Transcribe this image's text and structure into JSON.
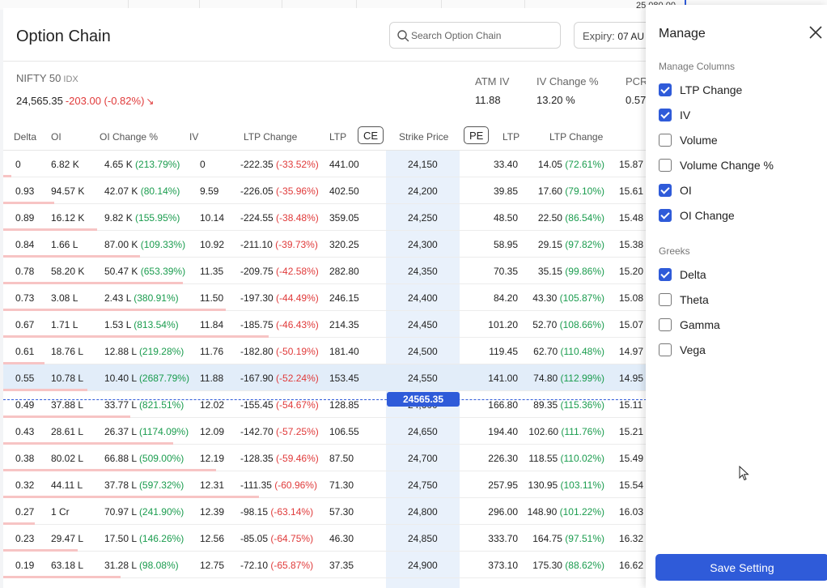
{
  "background_chart": {
    "price_label": "25,080.00"
  },
  "header": {
    "title": "Option Chain",
    "search_placeholder": "Search Option Chain",
    "expiry_label": "Expiry:",
    "expiry_value": "07 AU"
  },
  "instrument": {
    "name": "NIFTY 50",
    "type": "IDX",
    "ltp": "24,565.35",
    "change": "-203.00 (-0.82%)"
  },
  "stats": [
    {
      "label": "ATM IV",
      "value": "11.88"
    },
    {
      "label": "IV Change %",
      "value": "13.20 %"
    },
    {
      "label": "PCR",
      "value": "0.57"
    }
  ],
  "columns": {
    "delta": "Delta",
    "oi": "OI",
    "oi_change_pct": "OI Change %",
    "iv": "IV",
    "ltp_change_ce": "LTP Change",
    "ltp_ce": "LTP",
    "ce_badge": "CE",
    "strike": "Strike Price",
    "pe_badge": "PE",
    "ltp_pe": "LTP",
    "ltp_change_pe": "LTP Change"
  },
  "spot_marker": "24565.35",
  "rows": [
    {
      "delta": "0",
      "oi": "6.82 K",
      "oich": "4.65 K",
      "oichp": "(213.79%)",
      "iv": "0",
      "ltpch": "-222.35",
      "ltpchp": "(-33.52%)",
      "ltp": "441.00",
      "strike": "24,150",
      "peltp": "33.40",
      "peltpch": "14.05",
      "peltpchp": "(72.61%)",
      "peiv": "15.87"
    },
    {
      "delta": "0.93",
      "oi": "94.57 K",
      "oich": "42.07 K",
      "oichp": "(80.14%)",
      "iv": "9.59",
      "ltpch": "-226.05",
      "ltpchp": "(-35.96%)",
      "ltp": "402.50",
      "strike": "24,200",
      "peltp": "39.85",
      "peltpch": "17.60",
      "peltpchp": "(79.10%)",
      "peiv": "15.61"
    },
    {
      "delta": "0.89",
      "oi": "16.12 K",
      "oich": "9.82 K",
      "oichp": "(155.95%)",
      "iv": "10.14",
      "ltpch": "-224.55",
      "ltpchp": "(-38.48%)",
      "ltp": "359.05",
      "strike": "24,250",
      "peltp": "48.50",
      "peltpch": "22.50",
      "peltpchp": "(86.54%)",
      "peiv": "15.48"
    },
    {
      "delta": "0.84",
      "oi": "1.66 L",
      "oich": "87.00 K",
      "oichp": "(109.33%)",
      "iv": "10.92",
      "ltpch": "-211.10",
      "ltpchp": "(-39.73%)",
      "ltp": "320.25",
      "strike": "24,300",
      "peltp": "58.95",
      "peltpch": "29.15",
      "peltpchp": "(97.82%)",
      "peiv": "15.38"
    },
    {
      "delta": "0.78",
      "oi": "58.20 K",
      "oich": "50.47 K",
      "oichp": "(653.39%)",
      "iv": "11.35",
      "ltpch": "-209.75",
      "ltpchp": "(-42.58%)",
      "ltp": "282.80",
      "strike": "24,350",
      "peltp": "70.35",
      "peltpch": "35.15",
      "peltpchp": "(99.86%)",
      "peiv": "15.20"
    },
    {
      "delta": "0.73",
      "oi": "3.08 L",
      "oich": "2.43 L",
      "oichp": "(380.91%)",
      "iv": "11.50",
      "ltpch": "-197.30",
      "ltpchp": "(-44.49%)",
      "ltp": "246.15",
      "strike": "24,400",
      "peltp": "84.20",
      "peltpch": "43.30",
      "peltpchp": "(105.87%)",
      "peiv": "15.08"
    },
    {
      "delta": "0.67",
      "oi": "1.71 L",
      "oich": "1.53 L",
      "oichp": "(813.54%)",
      "iv": "11.84",
      "ltpch": "-185.75",
      "ltpchp": "(-46.43%)",
      "ltp": "214.35",
      "strike": "24,450",
      "peltp": "101.20",
      "peltpch": "52.70",
      "peltpchp": "(108.66%)",
      "peiv": "15.07"
    },
    {
      "delta": "0.61",
      "oi": "18.76 L",
      "oich": "12.88 L",
      "oichp": "(219.28%)",
      "iv": "11.76",
      "ltpch": "-182.80",
      "ltpchp": "(-50.19%)",
      "ltp": "181.40",
      "strike": "24,500",
      "peltp": "119.45",
      "peltpch": "62.70",
      "peltpchp": "(110.48%)",
      "peiv": "14.97"
    },
    {
      "delta": "0.55",
      "oi": "10.78 L",
      "oich": "10.40 L",
      "oichp": "(2687.79%)",
      "iv": "11.88",
      "ltpch": "-167.90",
      "ltpchp": "(-52.24%)",
      "ltp": "153.45",
      "strike": "24,550",
      "peltp": "141.00",
      "peltpch": "74.80",
      "peltpchp": "(112.99%)",
      "peiv": "14.95"
    },
    {
      "delta": "0.49",
      "oi": "37.88 L",
      "oich": "33.77 L",
      "oichp": "(821.51%)",
      "iv": "12.02",
      "ltpch": "-155.45",
      "ltpchp": "(-54.67%)",
      "ltp": "128.85",
      "strike": "24,600",
      "peltp": "166.80",
      "peltpch": "89.35",
      "peltpchp": "(115.36%)",
      "peiv": "15.11"
    },
    {
      "delta": "0.43",
      "oi": "28.61 L",
      "oich": "26.37 L",
      "oichp": "(1174.09%)",
      "iv": "12.09",
      "ltpch": "-142.70",
      "ltpchp": "(-57.25%)",
      "ltp": "106.55",
      "strike": "24,650",
      "peltp": "194.40",
      "peltpch": "102.60",
      "peltpchp": "(111.76%)",
      "peiv": "15.21"
    },
    {
      "delta": "0.38",
      "oi": "80.02 L",
      "oich": "66.88 L",
      "oichp": "(509.00%)",
      "iv": "12.19",
      "ltpch": "-128.35",
      "ltpchp": "(-59.46%)",
      "ltp": "87.50",
      "strike": "24,700",
      "peltp": "226.30",
      "peltpch": "118.55",
      "peltpchp": "(110.02%)",
      "peiv": "15.49"
    },
    {
      "delta": "0.32",
      "oi": "44.11 L",
      "oich": "37.78 L",
      "oichp": "(597.32%)",
      "iv": "12.31",
      "ltpch": "-111.35",
      "ltpchp": "(-60.96%)",
      "ltp": "71.30",
      "strike": "24,750",
      "peltp": "257.95",
      "peltpch": "130.95",
      "peltpchp": "(103.11%)",
      "peiv": "15.54"
    },
    {
      "delta": "0.27",
      "oi": "1 Cr",
      "oich": "70.97 L",
      "oichp": "(241.90%)",
      "iv": "12.39",
      "ltpch": "-98.15",
      "ltpchp": "(-63.14%)",
      "ltp": "57.30",
      "strike": "24,800",
      "peltp": "296.00",
      "peltpch": "148.90",
      "peltpchp": "(101.22%)",
      "peiv": "16.03"
    },
    {
      "delta": "0.23",
      "oi": "29.47 L",
      "oich": "17.50 L",
      "oichp": "(146.26%)",
      "iv": "12.56",
      "ltpch": "-85.05",
      "ltpchp": "(-64.75%)",
      "ltp": "46.30",
      "strike": "24,850",
      "peltp": "333.70",
      "peltpch": "164.75",
      "peltpchp": "(97.51%)",
      "peiv": "16.32"
    },
    {
      "delta": "0.19",
      "oi": "63.18 L",
      "oich": "31.28 L",
      "oichp": "(98.08%)",
      "iv": "12.75",
      "ltpch": "-72.10",
      "ltpchp": "(-65.87%)",
      "ltp": "37.35",
      "strike": "24,900",
      "peltp": "373.10",
      "peltpch": "175.30",
      "peltpchp": "(88.62%)",
      "peiv": "16.62"
    }
  ],
  "manage": {
    "title": "Manage",
    "columns_section": "Manage Columns",
    "columns": [
      {
        "label": "LTP Change",
        "checked": true
      },
      {
        "label": "IV",
        "checked": true
      },
      {
        "label": "Volume",
        "checked": false
      },
      {
        "label": "Volume Change %",
        "checked": false
      },
      {
        "label": "OI",
        "checked": true
      },
      {
        "label": "OI Change",
        "checked": true
      }
    ],
    "greeks_section": "Greeks",
    "greeks": [
      {
        "label": "Delta",
        "checked": true
      },
      {
        "label": "Theta",
        "checked": false
      },
      {
        "label": "Gamma",
        "checked": false
      },
      {
        "label": "Vega",
        "checked": false
      }
    ],
    "save_label": "Save Setting"
  },
  "colors": {
    "accent": "#2f5bd9",
    "negative": "#e03a3a",
    "positive": "#1a9c4e"
  }
}
